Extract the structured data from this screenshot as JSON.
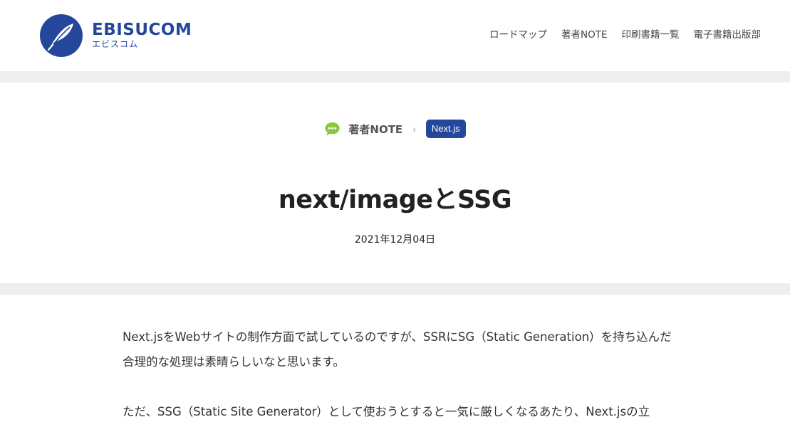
{
  "header": {
    "logo_name": "EBISUCOM",
    "logo_sub": "エビスコム",
    "nav": [
      {
        "label": "ロードマップ"
      },
      {
        "label": "著者NOTE"
      },
      {
        "label": "印刷書籍一覧"
      },
      {
        "label": "電子書籍出版部"
      }
    ]
  },
  "breadcrumb": {
    "icon": "speech-bubble-icon",
    "category": "著者NOTE",
    "separator": "›",
    "tag": "Next.js"
  },
  "article": {
    "title": "next/imageとSSG",
    "date": "2021年12月04日",
    "paragraphs": [
      "Next.jsをWebサイトの制作方面で試しているのですが、SSRにSG（Static Generation）を持ち込んだ合理的な処理は素晴らしいなと思います。",
      "ただ、SSG（Static Site Generator）として使おうとすると一気に厳しくなるあたり、Next.jsの立"
    ]
  },
  "colors": {
    "brand": "#25479b",
    "icon_green": "#8cc63f",
    "band": "#eeeeee"
  }
}
